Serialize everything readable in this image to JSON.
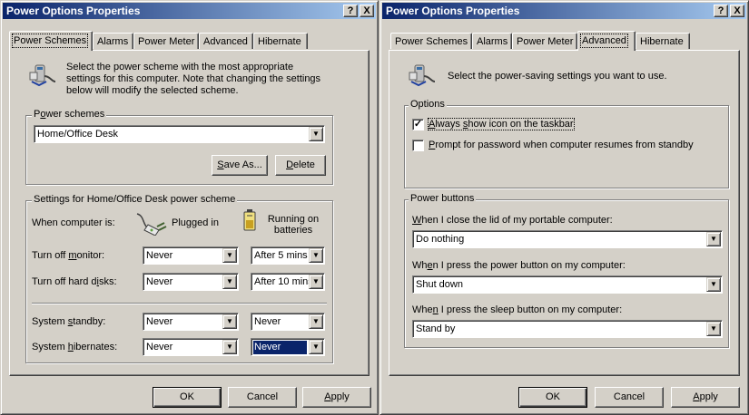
{
  "win1": {
    "title": "Power Options Properties",
    "help": "?",
    "close": "X",
    "tabs": [
      {
        "label": "Power Schemes"
      },
      {
        "label": "Alarms"
      },
      {
        "label": "Power Meter"
      },
      {
        "label": "Advanced"
      },
      {
        "label": "Hibernate"
      }
    ],
    "intro": "Select the power scheme with the most appropriate settings for this computer. Note that changing the settings below will modify the selected scheme.",
    "schemes_group": {
      "legend_pre": "P",
      "legend_u": "o",
      "legend_post": "wer schemes",
      "value": "Home/Office Desk",
      "save_as_u": "S",
      "save_as_post": "ave As...",
      "delete_u": "D",
      "delete_post": "elete"
    },
    "settings_group": {
      "legend": "Settings for Home/Office Desk power scheme",
      "when_label": "When computer is:",
      "plugged_in": "Plugged in",
      "running_on_batteries": "Running on batteries",
      "rows": [
        {
          "pre": "Turn off ",
          "u": "m",
          "post": "onitor:",
          "plugged": "Never",
          "battery": "After 5 mins"
        },
        {
          "pre": "Turn off hard d",
          "u": "i",
          "post": "sks:",
          "plugged": "Never",
          "battery": "After 10 mins"
        },
        {
          "pre": "System ",
          "u": "s",
          "post": "tandby:",
          "plugged": "Never",
          "battery": "Never"
        },
        {
          "pre": "System ",
          "u": "h",
          "post": "ibernates:",
          "plugged": "Never",
          "battery": "Never"
        }
      ]
    },
    "buttons": {
      "ok": "OK",
      "cancel": "Cancel",
      "apply_u": "A",
      "apply_post": "pply"
    }
  },
  "win2": {
    "title": "Power Options Properties",
    "help": "?",
    "close": "X",
    "tabs": [
      {
        "label": "Power Schemes"
      },
      {
        "label": "Alarms"
      },
      {
        "label": "Power Meter"
      },
      {
        "label": "Advanced"
      },
      {
        "label": "Hibernate"
      }
    ],
    "intro": "Select the power-saving settings you want to use.",
    "options_group": {
      "legend": "Options",
      "always_show_u": "A",
      "always_show_pre": "",
      "always_show_mid": "lways ",
      "always_show_u2": "s",
      "always_show_post": "how icon on the taskbar",
      "always_show_checked": true,
      "prompt_u": "P",
      "prompt_post": "rompt for password when computer resumes from standby",
      "prompt_checked": false
    },
    "buttons_group": {
      "legend": "Power buttons",
      "lid_u": "W",
      "lid_post": "hen I close the lid of my portable computer:",
      "lid_value": "Do nothing",
      "power_pre": "Wh",
      "power_u": "e",
      "power_post": "n I press the power button on my computer:",
      "power_value": "Shut down",
      "sleep_pre": "Whe",
      "sleep_u": "n",
      "sleep_post": " I press the sleep button on my computer:",
      "sleep_value": "Stand by"
    },
    "buttons": {
      "ok": "OK",
      "cancel": "Cancel",
      "apply_u": "A",
      "apply_post": "pply"
    }
  },
  "icons": {
    "power": "power-options-icon",
    "plug": "plug-icon",
    "battery": "battery-icon"
  }
}
